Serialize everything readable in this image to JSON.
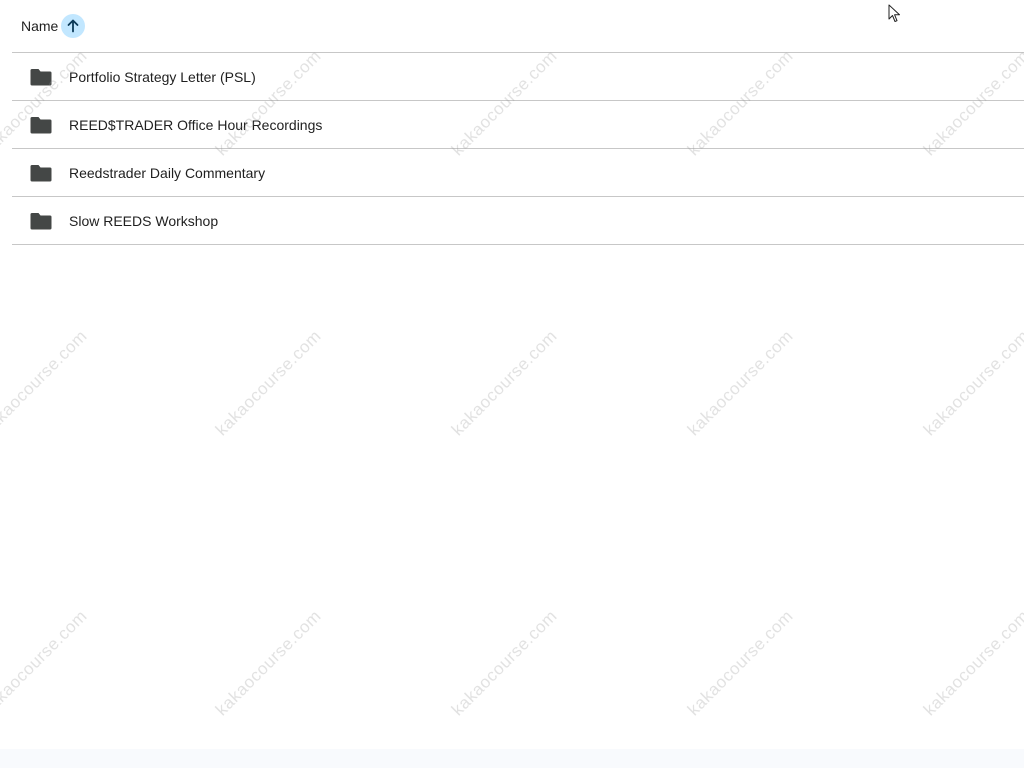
{
  "header": {
    "name_label": "Name",
    "sort_icon": "arrow-upward-icon"
  },
  "folders": [
    {
      "label": "Portfolio Strategy Letter (PSL)",
      "icon": "folder-icon"
    },
    {
      "label": "REED$TRADER Office Hour Recordings",
      "icon": "folder-icon"
    },
    {
      "label": "Reedstrader Daily Commentary",
      "icon": "folder-icon"
    },
    {
      "label": "Slow REEDS Workshop",
      "icon": "folder-icon"
    }
  ],
  "watermark": {
    "text": "kakaocourse.com"
  },
  "colors": {
    "sort_button_bg": "#c2e7ff",
    "folder_icon": "#444746",
    "divider": "#c7c7c7",
    "text": "#1f1f1f"
  }
}
